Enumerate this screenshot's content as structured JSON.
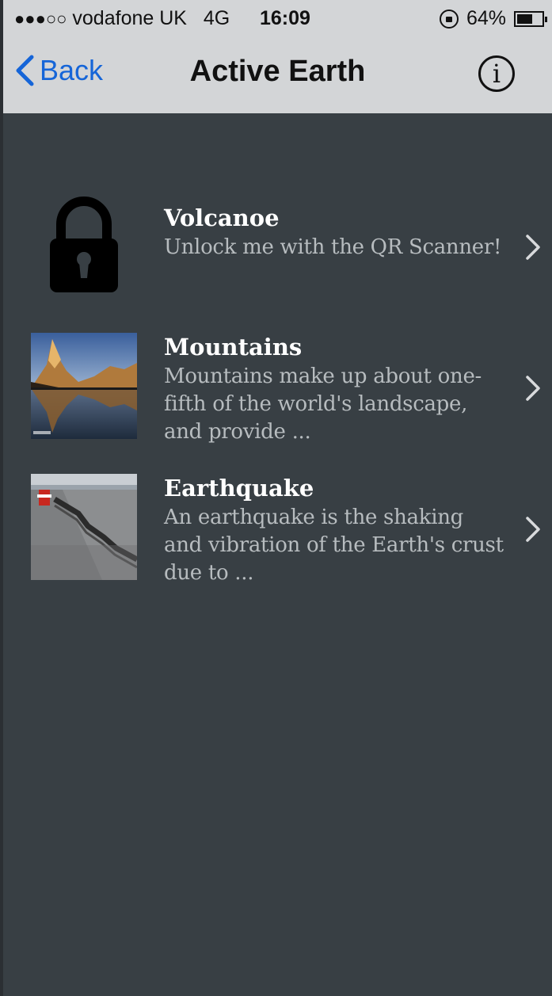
{
  "status_bar": {
    "signal": "●●●○○",
    "carrier": "vodafone UK",
    "network": "4G",
    "time": "16:09",
    "battery": "64%",
    "battery_level": 0.64
  },
  "nav": {
    "back_label": "Back",
    "title": "Active Earth"
  },
  "items": [
    {
      "title": "Volcanoe",
      "description": "Unlock me with the QR Scanner!",
      "locked": true
    },
    {
      "title": "Mountains",
      "description": "Mountains make up about one-fifth of the world's landscape, and provide ...",
      "locked": false
    },
    {
      "title": "Earthquake",
      "description": "An earthquake is the shaking and vibration of the Earth's crust due to ...",
      "locked": false
    }
  ]
}
